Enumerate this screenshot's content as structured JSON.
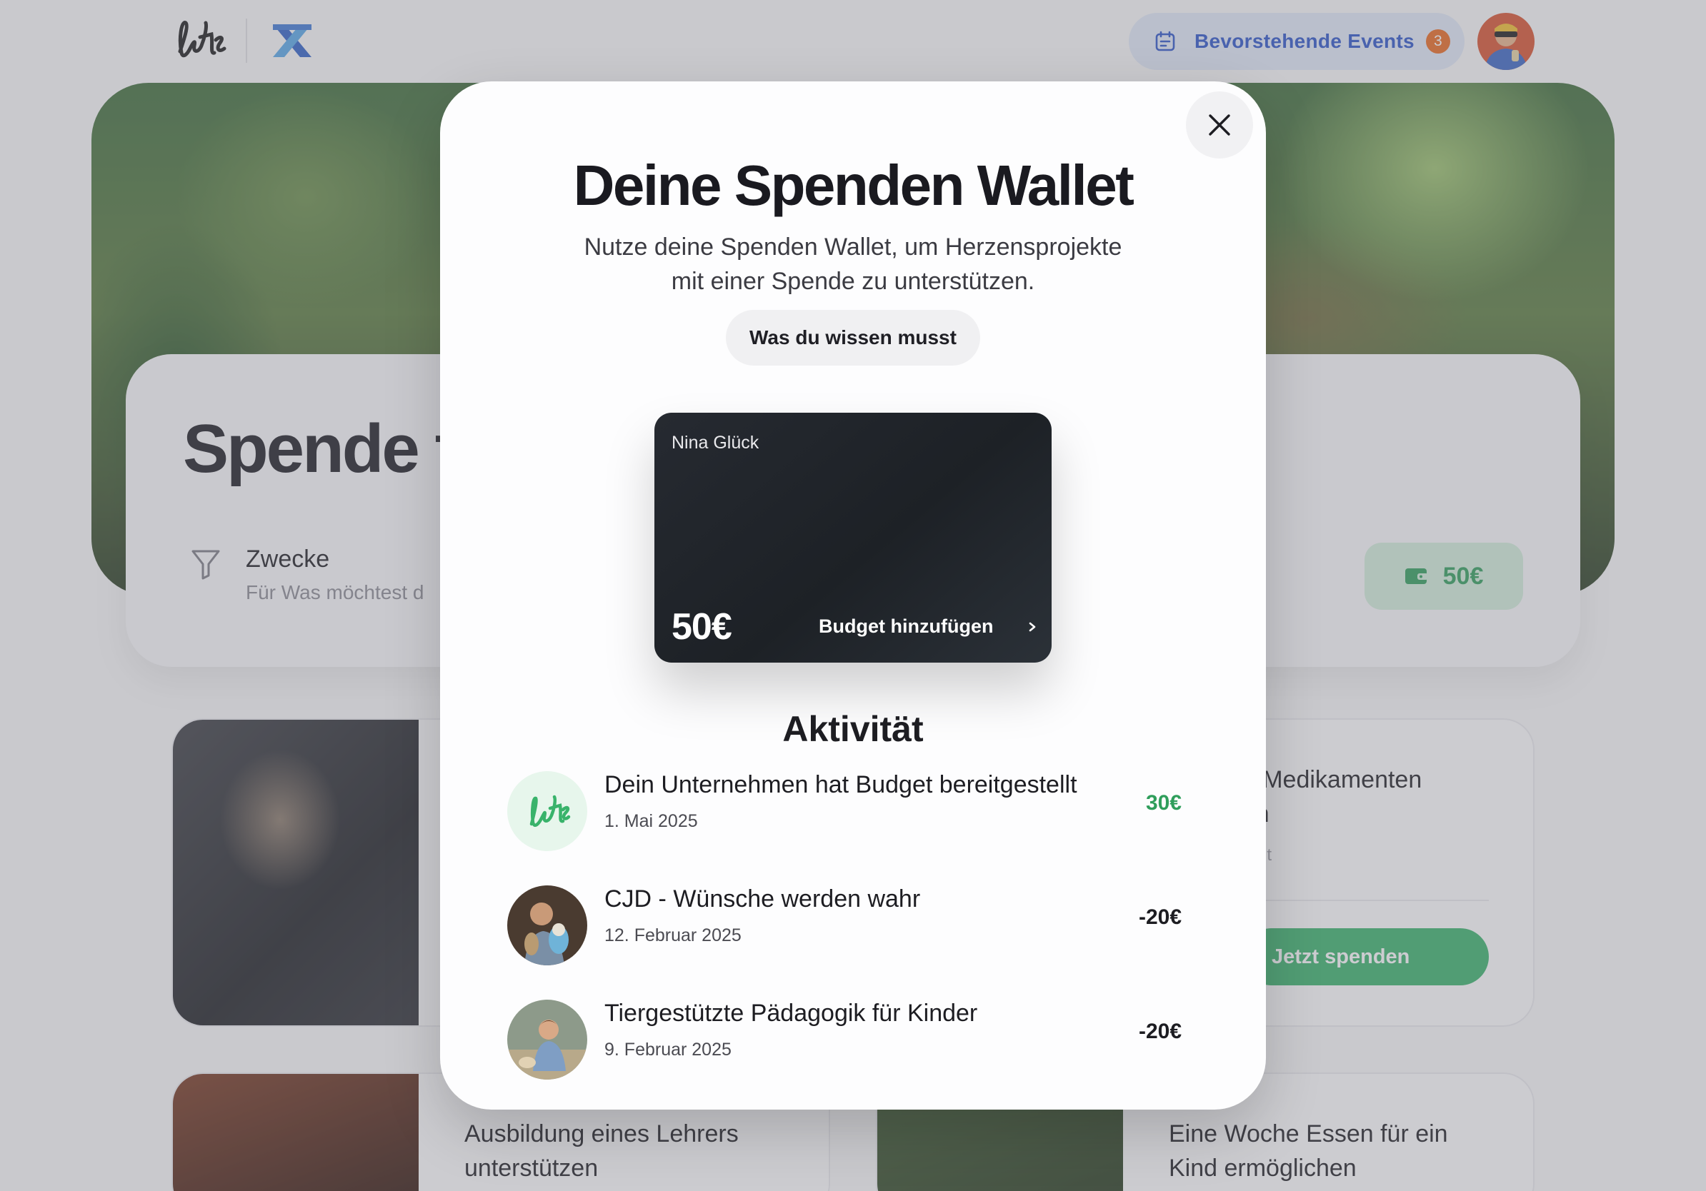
{
  "header": {
    "events_label": "Bevorstehende Events",
    "events_count": "3"
  },
  "page": {
    "title": "Spende f",
    "filter_label": "Zwecke",
    "filter_sub": "Für Was möchtest d",
    "wallet_amount": "50€",
    "projects": [
      {
        "title_line1": "ria Medikamenten",
        "title_line2": "tten",
        "meta": "it",
        "button": "Jetzt spenden"
      },
      {
        "title_line1": "Ausbildung eines Lehrers",
        "title_line2": "unterstützen"
      },
      {
        "title_line1": "Eine Woche Essen für ein",
        "title_line2": "Kind ermöglichen"
      }
    ]
  },
  "modal": {
    "title": "Deine Spenden Wallet",
    "subtitle_line1": "Nutze deine Spenden Wallet, um Herzensprojekte",
    "subtitle_line2": "mit einer Spende zu unterstützen.",
    "info_button": "Was du wissen musst",
    "card": {
      "holder": "Nina Glück",
      "amount": "50€",
      "add_budget": "Budget hinzufügen"
    },
    "activity_title": "Aktivität",
    "activities": [
      {
        "title": "Dein Unternehmen hat Budget bereitgestellt",
        "date": "1. Mai 2025",
        "amount": "30€",
        "amount_color": "#2f9e5b"
      },
      {
        "title": "CJD - Wünsche werden wahr",
        "date": "12. Februar 2025",
        "amount": "-20€",
        "amount_color": "#1d1d22"
      },
      {
        "title": "Tiergestützte Pädagogik für Kinder",
        "date": "9. Februar 2025",
        "amount": "-20€",
        "amount_color": "#1d1d22"
      }
    ]
  },
  "colors": {
    "accent_blue": "#2d55c9",
    "accent_green": "#39b36b",
    "badge_orange": "#ea6a1f",
    "card_dark": "#23272d"
  },
  "icons": [
    "lets-logo",
    "x-logo",
    "calendar-icon",
    "close-icon",
    "funnel-icon",
    "wallet-icon",
    "chevron-right-icon"
  ]
}
